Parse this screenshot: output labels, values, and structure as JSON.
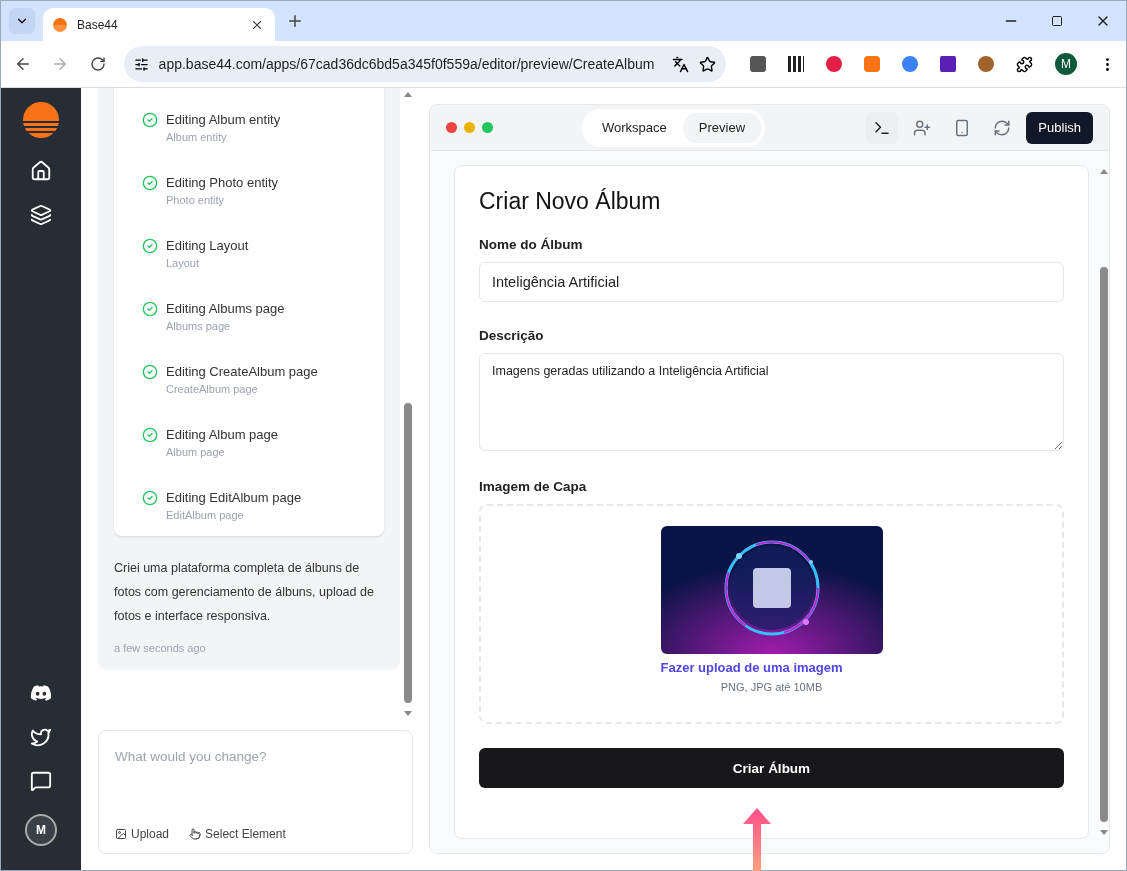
{
  "browser": {
    "tab_title": "Base44",
    "url": "app.base44.com/apps/67cad36dc6bd5a345f0f559a/editor/preview/CreateAlbum",
    "profile_initial": "M"
  },
  "rail": {
    "avatar_initial": "M"
  },
  "chat": {
    "steps": [
      {
        "title": "Editing Album entity",
        "subtitle": "Album entity",
        "done": true
      },
      {
        "title": "Editing Photo entity",
        "subtitle": "Photo entity",
        "done": true
      },
      {
        "title": "Editing Layout",
        "subtitle": "Layout",
        "done": true
      },
      {
        "title": "Editing Albums page",
        "subtitle": "Albums page",
        "done": true
      },
      {
        "title": "Editing CreateAlbum page",
        "subtitle": "CreateAlbum page",
        "done": true
      },
      {
        "title": "Editing Album page",
        "subtitle": "Album page",
        "done": true
      },
      {
        "title": "Editing EditAlbum page",
        "subtitle": "EditAlbum page",
        "done": true
      }
    ],
    "message": "Criei uma plataforma completa de álbuns de fotos com gerenciamento de álbuns, upload de fotos e interface responsiva.",
    "timestamp": "a few seconds ago",
    "input": {
      "placeholder": "What would you change?"
    },
    "actions": [
      {
        "label": "Upload",
        "kind": "upload"
      },
      {
        "label": "Select Element",
        "kind": "select"
      }
    ]
  },
  "preview": {
    "tabs": [
      {
        "label": "Workspace",
        "selected": false
      },
      {
        "label": "Preview",
        "selected": true
      }
    ],
    "publish": "Publish",
    "form": {
      "title": "Criar Novo Álbum",
      "name_label": "Nome do Álbum",
      "name_value": "Inteligência Artificial",
      "description_label": "Descrição",
      "description_value": "Imagens geradas utilizando a Inteligência Artificial",
      "cover_label": "Imagem de Capa",
      "upload_link": "Fazer upload de uma imagem",
      "upload_hint": "PNG, JPG até 10MB",
      "submit": "Criar Álbum"
    }
  }
}
